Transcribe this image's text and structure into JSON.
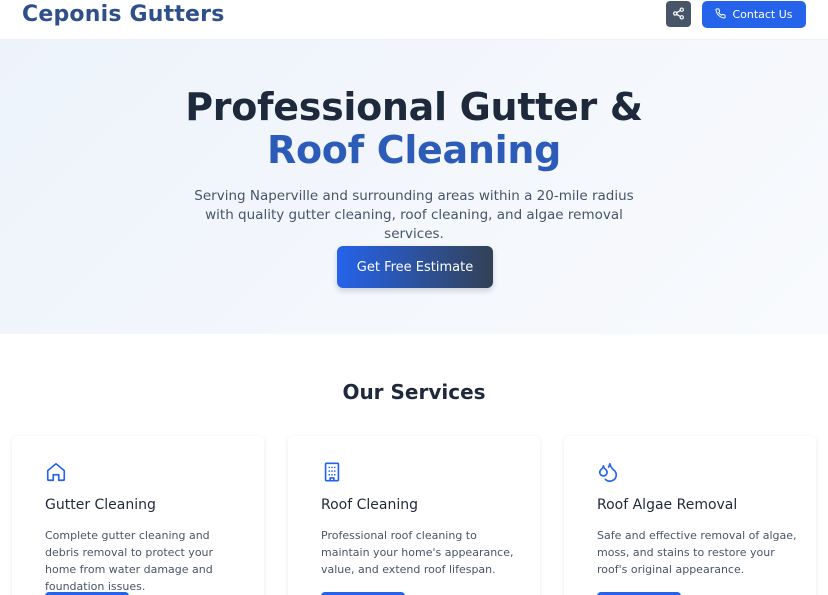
{
  "header": {
    "brand": "Ceponis Gutters",
    "share_icon": "share-icon",
    "contact_label": "Contact Us",
    "contact_icon": "phone-icon"
  },
  "hero": {
    "title_line1": "Professional Gutter &",
    "title_line2": "Roof Cleaning",
    "subtitle": "Serving Naperville and surrounding areas within a 20-mile radius with quality gutter cleaning, roof cleaning, and algae removal services.",
    "cta_label": "Get Free Estimate"
  },
  "services": {
    "title": "Our Services",
    "items": [
      {
        "icon": "home-icon",
        "title": "Gutter Cleaning",
        "text": "Complete gutter cleaning and debris removal to protect your home from water damage and foundation issues."
      },
      {
        "icon": "building-icon",
        "title": "Roof Cleaning",
        "text": "Professional roof cleaning to maintain your home's appearance, value, and extend roof lifespan."
      },
      {
        "icon": "droplets-icon",
        "title": "Roof Algae Removal",
        "text": "Safe and effective removal of algae, moss, and stains to restore your roof's original appearance."
      }
    ]
  },
  "colors": {
    "brand": "#2f4f8a",
    "accent": "#2563eb",
    "heading": "#1e293b",
    "text": "#475569"
  }
}
